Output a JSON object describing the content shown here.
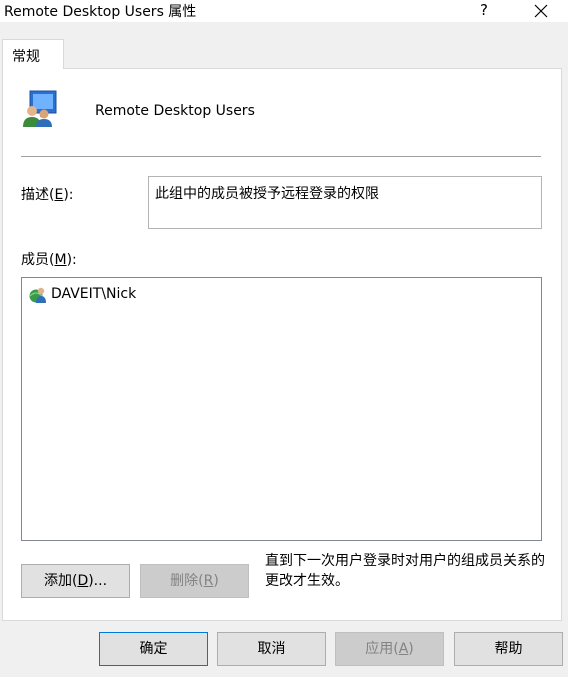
{
  "window": {
    "title": "Remote Desktop Users 属性",
    "help_label": "?"
  },
  "tab": {
    "label": "常规"
  },
  "group": {
    "name": "Remote Desktop Users"
  },
  "description": {
    "label_prefix": "描述(",
    "label_mnemonic": "E",
    "label_suffix": "):",
    "value": "此组中的成员被授予远程登录的权限"
  },
  "members": {
    "label_prefix": "成员(",
    "label_mnemonic": "M",
    "label_suffix": "):",
    "items": [
      {
        "name": "DAVEIT\\Nick"
      }
    ]
  },
  "actions": {
    "add": {
      "prefix": "添加(",
      "mnemonic": "D",
      "suffix": ")..."
    },
    "remove": {
      "prefix": "删除(",
      "mnemonic": "R",
      "suffix": ")"
    }
  },
  "note": "直到下一次用户登录时对用户的组成员关系的更改才生效。",
  "footer": {
    "ok": "确定",
    "cancel": "取消",
    "apply": {
      "prefix": "应用(",
      "mnemonic": "A",
      "suffix": ")"
    },
    "help": "帮助"
  },
  "colors": {
    "default_button_border": "#0078d7",
    "disabled_text": "#838383"
  }
}
